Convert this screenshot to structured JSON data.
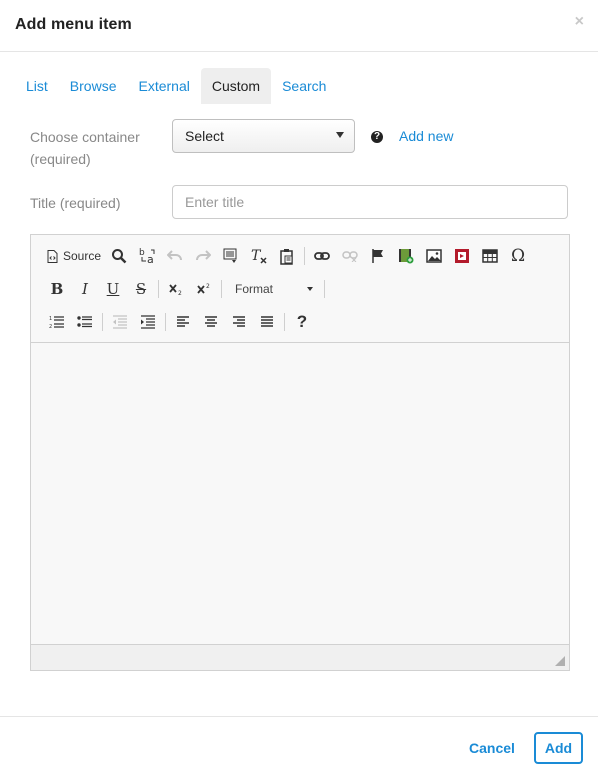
{
  "dialog": {
    "title": "Add menu item",
    "close_label": "×"
  },
  "tabs": [
    {
      "label": "List"
    },
    {
      "label": "Browse"
    },
    {
      "label": "External"
    },
    {
      "label": "Custom",
      "active": true
    },
    {
      "label": "Search"
    }
  ],
  "container": {
    "label": "Choose container (required)",
    "select_value": "Select",
    "help_icon": "question-circle-icon",
    "add_new_label": "Add new"
  },
  "title_field": {
    "label": "Title (required)",
    "placeholder": "Enter title",
    "value": ""
  },
  "editor": {
    "source_label": "Source",
    "format_label": "Format",
    "toolbar_row1": [
      "source-icon",
      "find-icon",
      "replace-icon",
      "undo-icon",
      "redo-icon",
      "select-all-icon",
      "remove-format-icon",
      "paste-text-icon",
      "link-icon",
      "unlink-icon",
      "anchor-flag-icon",
      "media-icon",
      "image-icon",
      "video-icon",
      "table-icon",
      "special-char-icon"
    ],
    "toolbar_row2": [
      "bold-icon",
      "italic-icon",
      "underline-icon",
      "strike-icon",
      "subscript-icon",
      "superscript-icon",
      "format-dropdown"
    ],
    "toolbar_row3": [
      "numbered-list-icon",
      "bullet-list-icon",
      "outdent-icon",
      "indent-icon",
      "align-left-icon",
      "align-center-icon",
      "align-right-icon",
      "justify-icon",
      "help-icon"
    ],
    "content": ""
  },
  "footer": {
    "cancel_label": "Cancel",
    "add_label": "Add"
  },
  "colors": {
    "link": "#1a8bd6",
    "active_tab_bg": "#eeeeee",
    "label_gray": "#888888"
  }
}
